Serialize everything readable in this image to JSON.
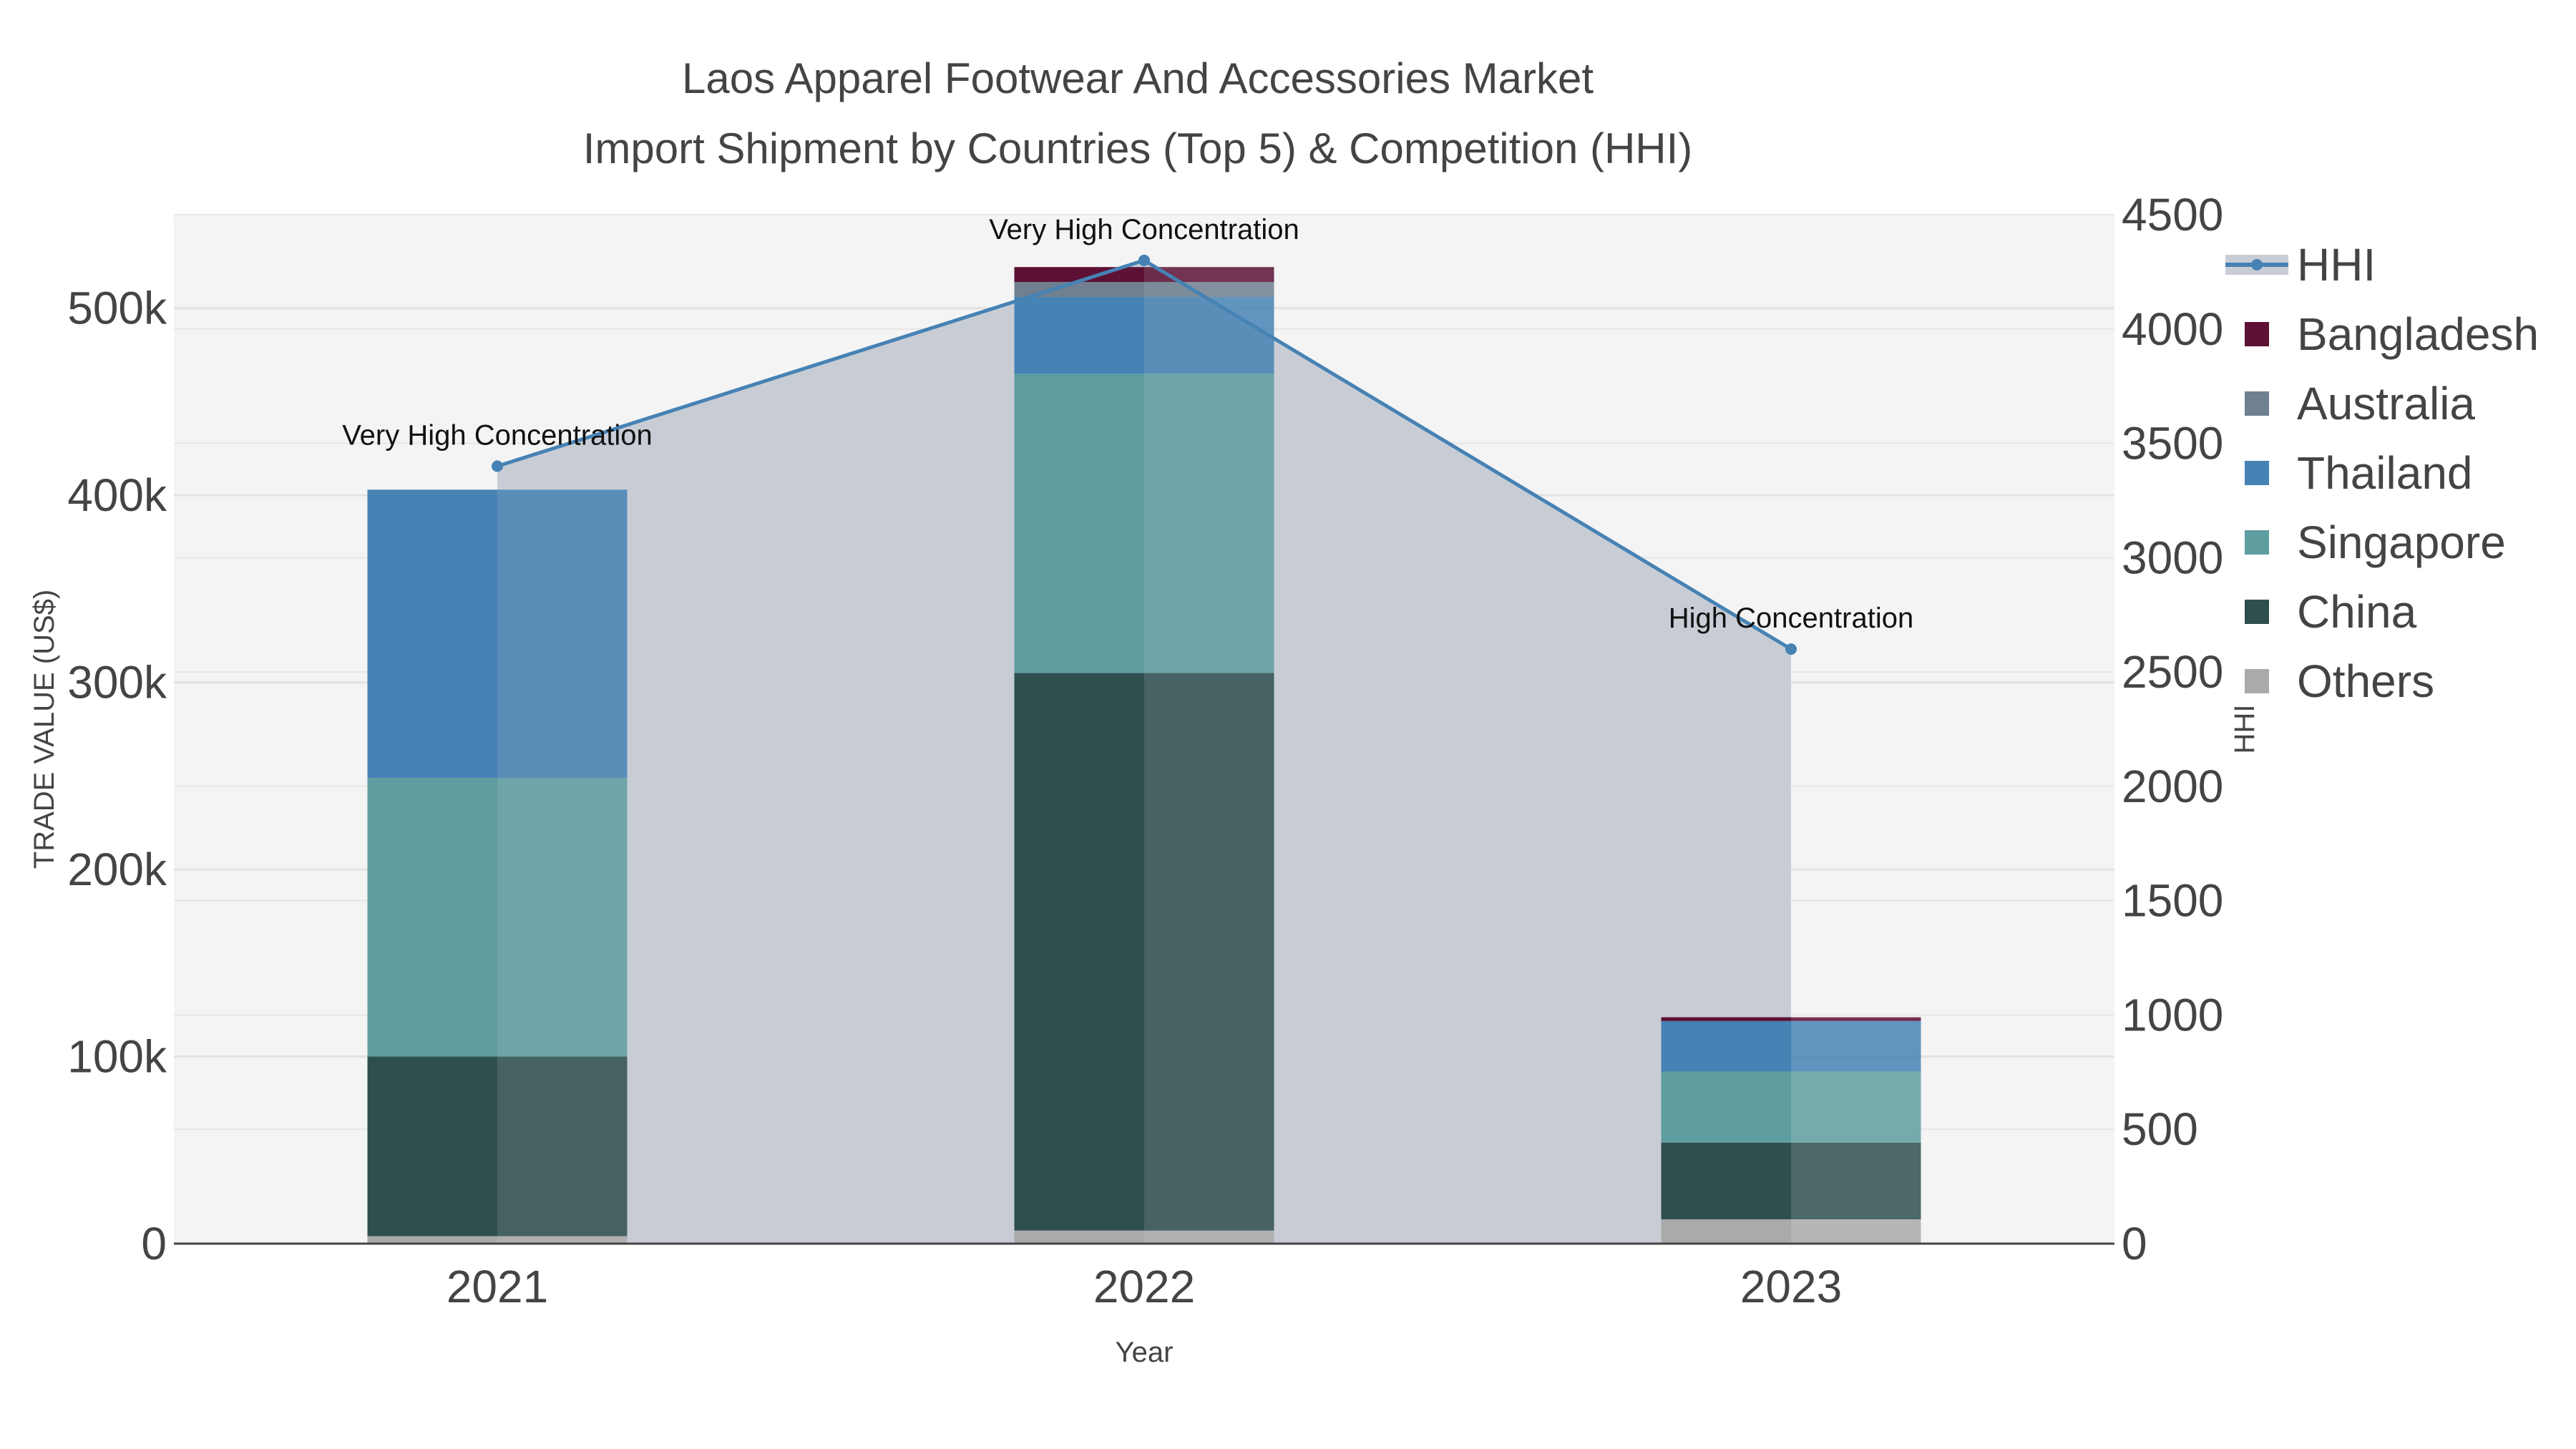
{
  "chart_data": {
    "type": "bar",
    "title_lines": [
      "Laos Apparel Footwear And Accessories Market",
      "Import Shipment by Countries (Top 5) & Competition (HHI)"
    ],
    "xlabel": "Year",
    "ylabel": "TRADE VALUE (US$)",
    "y2label": "HHI",
    "categories": [
      "2021",
      "2022",
      "2023"
    ],
    "ylim": [
      0,
      550000
    ],
    "y2lim": [
      0,
      4500
    ],
    "yticks": [
      0,
      100000,
      200000,
      300000,
      400000,
      500000
    ],
    "ytick_labels": [
      "0",
      "100k",
      "200k",
      "300k",
      "400k",
      "500k"
    ],
    "y2ticks": [
      0,
      500,
      1000,
      1500,
      2000,
      2500,
      3000,
      3500,
      4000,
      4500
    ],
    "y2tick_labels": [
      "0",
      "500",
      "1000",
      "1500",
      "2000",
      "2500",
      "3000",
      "3500",
      "4000",
      "4500"
    ],
    "series": [
      {
        "name": "Others",
        "color": "#aaaaaa",
        "values": [
          4000,
          7000,
          13000
        ]
      },
      {
        "name": "China",
        "color": "#2f4f4f",
        "values": [
          96000,
          298000,
          41000
        ]
      },
      {
        "name": "Singapore",
        "color": "#5f9ea0",
        "values": [
          149000,
          160000,
          38000
        ]
      },
      {
        "name": "Thailand",
        "color": "#4682b4",
        "values": [
          154000,
          41000,
          27000
        ]
      },
      {
        "name": "Australia",
        "color": "#708090",
        "values": [
          0,
          8000,
          0
        ]
      },
      {
        "name": "Bangladesh",
        "color": "#5c1135",
        "values": [
          0,
          8000,
          2000
        ]
      }
    ],
    "hhi": {
      "name": "HHI",
      "color": "#4682b4",
      "values": [
        3400,
        4300,
        2600
      ],
      "annotations": [
        "Very High Concentration",
        "Very High Concentration",
        "High Concentration"
      ]
    },
    "legend_order": [
      "HHI",
      "Bangladesh",
      "Australia",
      "Thailand",
      "Singapore",
      "China",
      "Others"
    ],
    "legend_position": "right",
    "grid": true,
    "plot_background": "#f4f4f4",
    "hhi_area_color": "#c8cdd5"
  }
}
